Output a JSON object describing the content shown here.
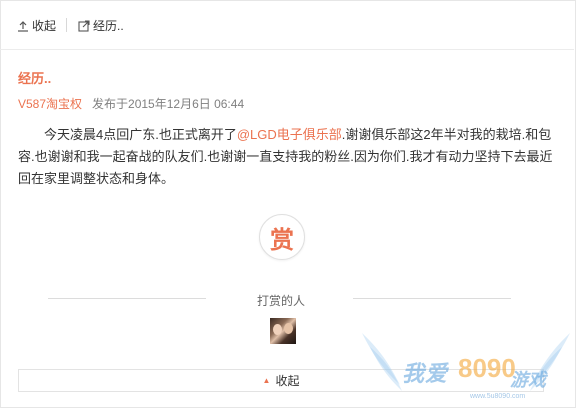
{
  "toolbar": {
    "collapse_label": "收起",
    "origin_label": "经历.."
  },
  "post": {
    "title": "经历..",
    "author": "V587淘宝权",
    "date": "发布于2015年12月6日 06:44",
    "content_before": "今天凌晨4点回广东.也正式离开了",
    "mention": "@LGD电子俱乐部",
    "content_after": ".谢谢俱乐部这2年半对我的栽培.和包容.也谢谢和我一起奋战的队友们.也谢谢一直支持我的粉丝.因为你们.我才有动力坚持下去最近回在家里调整状态和身体。"
  },
  "reward": {
    "button_char": "赏",
    "label": "打赏的人"
  },
  "footer": {
    "collapse_label": "收起"
  },
  "watermark": {
    "text_1": "我爱",
    "text_2": "8090",
    "text_3": "游戏",
    "url": "www.5u8090.com"
  },
  "colors": {
    "accent": "#eb7350",
    "watermark_blue": "#5aa0dc",
    "watermark_orange": "#f4a83a"
  },
  "icons": {
    "collapse": "arrow-up-bar-icon",
    "open_link": "external-link-icon",
    "triangle_up": "triangle-up-icon"
  }
}
